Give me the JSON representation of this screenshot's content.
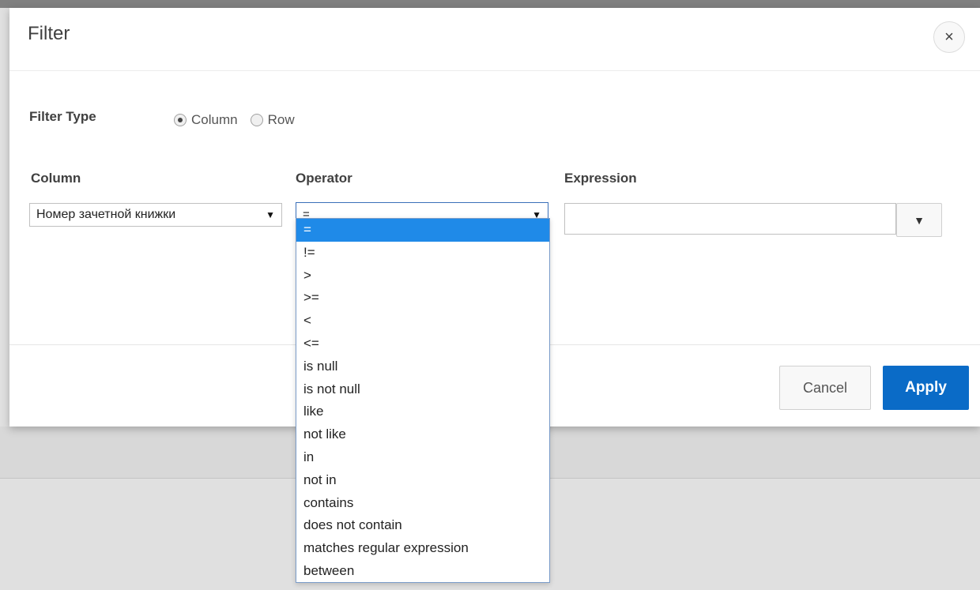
{
  "dialog": {
    "title": "Filter",
    "close_icon": "×"
  },
  "filter_type": {
    "label": "Filter Type",
    "options": [
      {
        "label": "Column",
        "checked": true
      },
      {
        "label": "Row",
        "checked": false
      }
    ]
  },
  "column": {
    "label": "Column",
    "selected": "Номер зачетной книжки"
  },
  "operator": {
    "label": "Operator",
    "selected": "=",
    "options": [
      "=",
      "!=",
      ">",
      ">=",
      "<",
      "<=",
      "is null",
      "is not null",
      "like",
      "not like",
      "in",
      "not in",
      "contains",
      "does not contain",
      "matches regular expression",
      "between"
    ],
    "highlighted_index": 0
  },
  "expression": {
    "label": "Expression",
    "value": "",
    "dropdown_icon": "▼"
  },
  "footer": {
    "cancel_label": "Cancel",
    "apply_label": "Apply"
  },
  "colors": {
    "accent": "#0a6bc7",
    "highlight": "#1f8ae8",
    "focus_border": "#3a6fb8"
  },
  "icons": {
    "close": "close-icon",
    "caret": "caret-down-icon"
  }
}
